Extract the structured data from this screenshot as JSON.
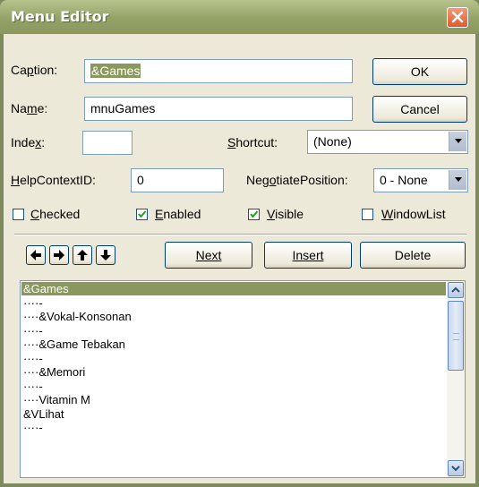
{
  "window": {
    "title": "Menu Editor"
  },
  "fields": {
    "caption_label": "Caption:",
    "caption_value": "&Games",
    "name_label": "Name:",
    "name_value": "mnuGames",
    "index_label": "Index:",
    "index_value": "",
    "shortcut_label": "Shortcut:",
    "shortcut_value": "(None)",
    "helpcontext_label": "HelpContextID:",
    "helpcontext_value": "0",
    "negotiate_label": "NegotiatePosition:",
    "negotiate_value": "0 - None"
  },
  "checkboxes": [
    {
      "label": "Checked",
      "checked": false
    },
    {
      "label": "Enabled",
      "checked": true
    },
    {
      "label": "Visible",
      "checked": true
    },
    {
      "label": "WindowList",
      "checked": false
    }
  ],
  "buttons": {
    "ok": "OK",
    "cancel": "Cancel",
    "next": "Next",
    "insert": "Insert",
    "delete": "Delete"
  },
  "list": {
    "selected_index": 0,
    "items": [
      "&Games",
      "····-",
      "····&Vokal-Konsonan",
      "····-",
      "····&Game Tebakan",
      "····-",
      "····&Memori",
      "····-",
      "····Vitamin M",
      "&VLihat",
      "····-"
    ]
  },
  "colors": {
    "accent": "#8a985e",
    "titlebar": "#94a268",
    "close": "#e05a2c",
    "face": "#ece9d8"
  }
}
